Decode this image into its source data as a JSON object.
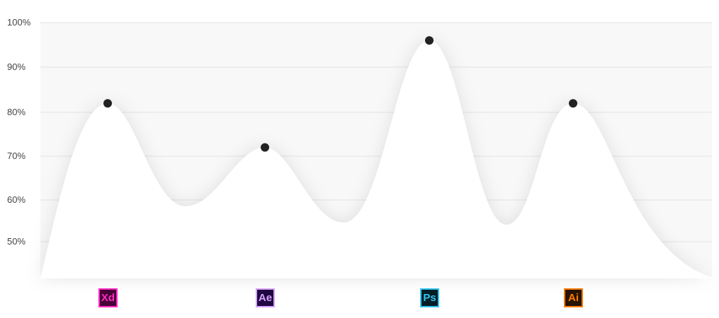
{
  "chart_data": {
    "type": "area",
    "categories": [
      "Xd",
      "Ae",
      "Ps",
      "Ai"
    ],
    "values": [
      82,
      72,
      96,
      82
    ],
    "ylim": [
      42,
      100
    ],
    "y_ticks": [
      "100%",
      "90%",
      "80%",
      "70%",
      "60%",
      "50%"
    ],
    "y_tick_values": [
      100,
      90,
      80,
      70,
      60,
      50
    ],
    "grid": true,
    "marker_color": "#222222",
    "background_fill": "#f8f8f8",
    "area_fill": "#ffffff"
  },
  "icons": [
    {
      "label": "Xd",
      "icon": "adobe-xd-icon",
      "fg": "#ff2bc2",
      "bg": "#470137",
      "border": "#ff2bc2"
    },
    {
      "label": "Ae",
      "icon": "adobe-after-effects-icon",
      "fg": "#d8a1ff",
      "bg": "#1f0740",
      "border": "#d8a1ff"
    },
    {
      "label": "Ps",
      "icon": "adobe-photoshop-icon",
      "fg": "#31c5f0",
      "bg": "#001d26",
      "border": "#31c5f0"
    },
    {
      "label": "Ai",
      "icon": "adobe-illustrator-icon",
      "fg": "#ff7c00",
      "bg": "#261300",
      "border": "#ff7c00"
    }
  ]
}
